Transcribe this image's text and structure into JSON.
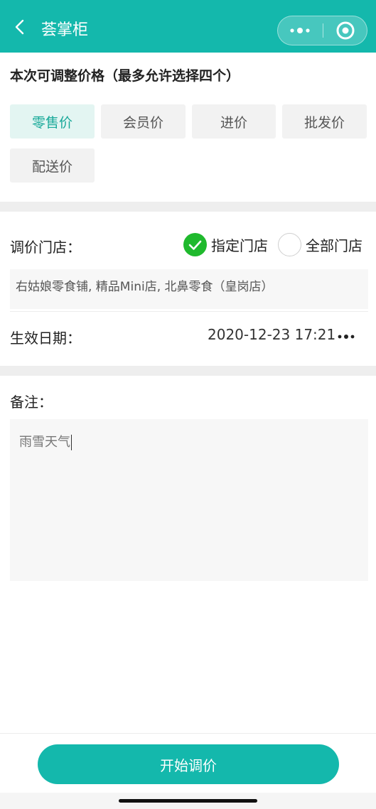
{
  "navbar": {
    "title": "荟掌柜",
    "back_icon": "chevron-left-icon",
    "more_icon": "more-dots-icon",
    "close_icon": "record-circle-icon",
    "background": "#14b8ac"
  },
  "price_section": {
    "title": "本次可调整价格（最多允许选择四个）",
    "options": [
      {
        "label": "零售价",
        "selected": true
      },
      {
        "label": "会员价",
        "selected": false
      },
      {
        "label": "进价",
        "selected": false
      },
      {
        "label": "批发价",
        "selected": false
      },
      {
        "label": "配送价",
        "selected": false
      }
    ]
  },
  "store_section": {
    "label": "调价门店：",
    "radio_specified": {
      "label": "指定门店",
      "checked": true
    },
    "radio_all": {
      "label": "全部门店",
      "checked": false
    },
    "selected_stores": "右姑娘零食铺, 精品Mini店, 北鼻零食（皇岗店）"
  },
  "date_section": {
    "label": "生效日期：",
    "value": "2020-12-23 17:21",
    "more_icon": "more-dots-icon"
  },
  "note_section": {
    "label": "备注：",
    "value": "雨雪天气"
  },
  "footer": {
    "button_label": "开始调价"
  },
  "colors": {
    "accent": "#14b8ac",
    "selected_text": "#18a999",
    "check_green": "#1fb92d"
  }
}
